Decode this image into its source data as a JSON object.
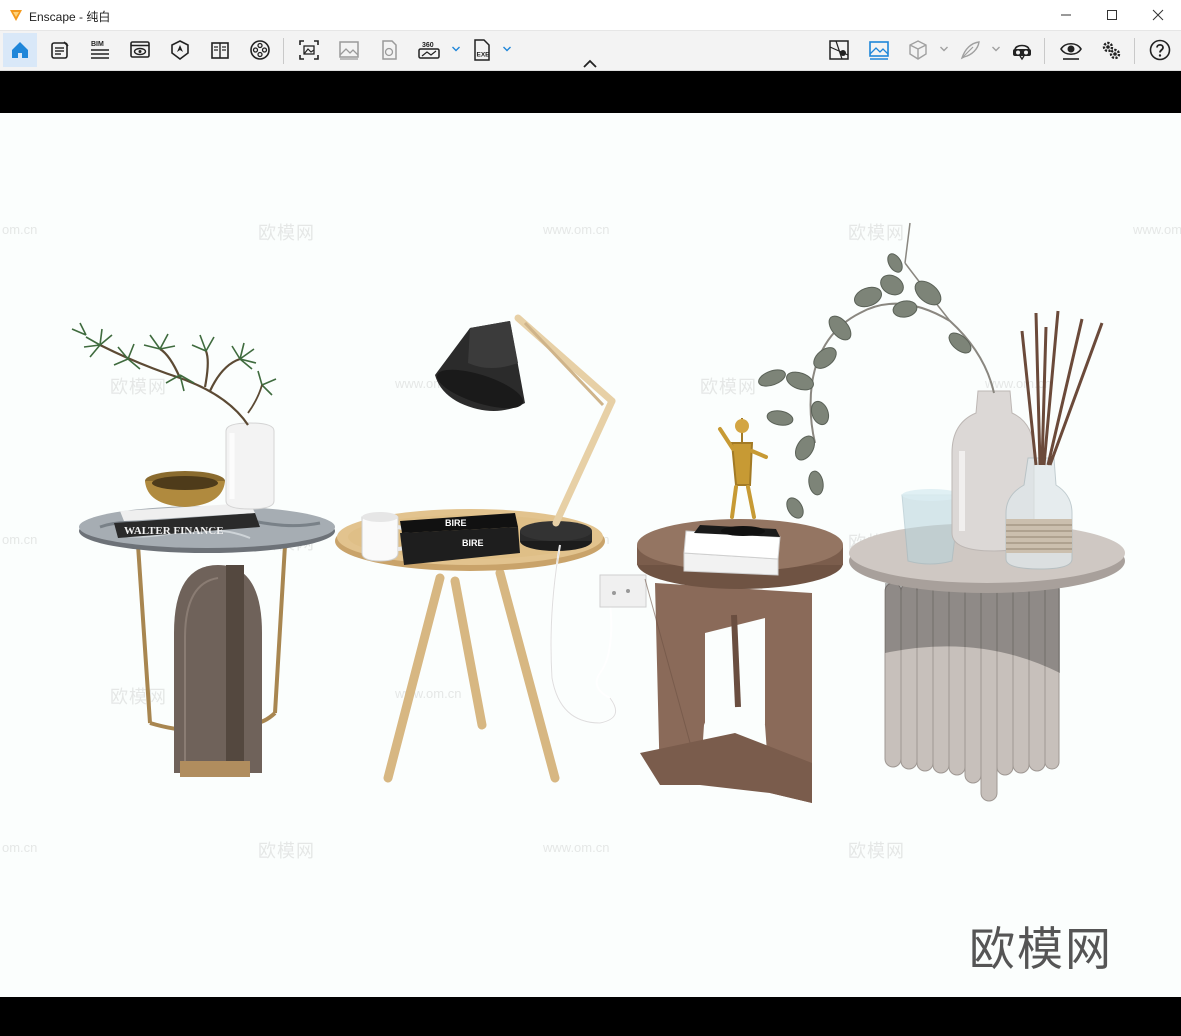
{
  "window": {
    "title": "Enscape - 纯白",
    "minimize_icon": "minimize-icon",
    "maximize_icon": "maximize-icon",
    "close_icon": "close-icon"
  },
  "toolbar": {
    "bim_label": "BIM",
    "pano_label": "360",
    "exe_label": "EXE",
    "accent_color": "#1f86d9",
    "left_tools": [
      "home-icon",
      "notepad-icon",
      "bim-icon",
      "view-icon",
      "visual-settings-icon",
      "book-icon",
      "video-reel-icon",
      "screenshot-icon",
      "image-icon",
      "batch-render-icon",
      "panorama-360-icon",
      "exe-export-icon"
    ],
    "right_tools": [
      "map-icon",
      "image-viewer-icon",
      "cube-icon",
      "feather-icon",
      "vr-headset-icon",
      "eye-icon",
      "gears-icon",
      "help-icon"
    ]
  },
  "scene": {
    "book_title": "WALTER FINANCE",
    "book_spine": "BIRE",
    "brand_watermark": "欧模网",
    "watermark_cn": "欧模网",
    "watermark_url": "www.om.cn",
    "watermark_url_short": "om.cn"
  }
}
